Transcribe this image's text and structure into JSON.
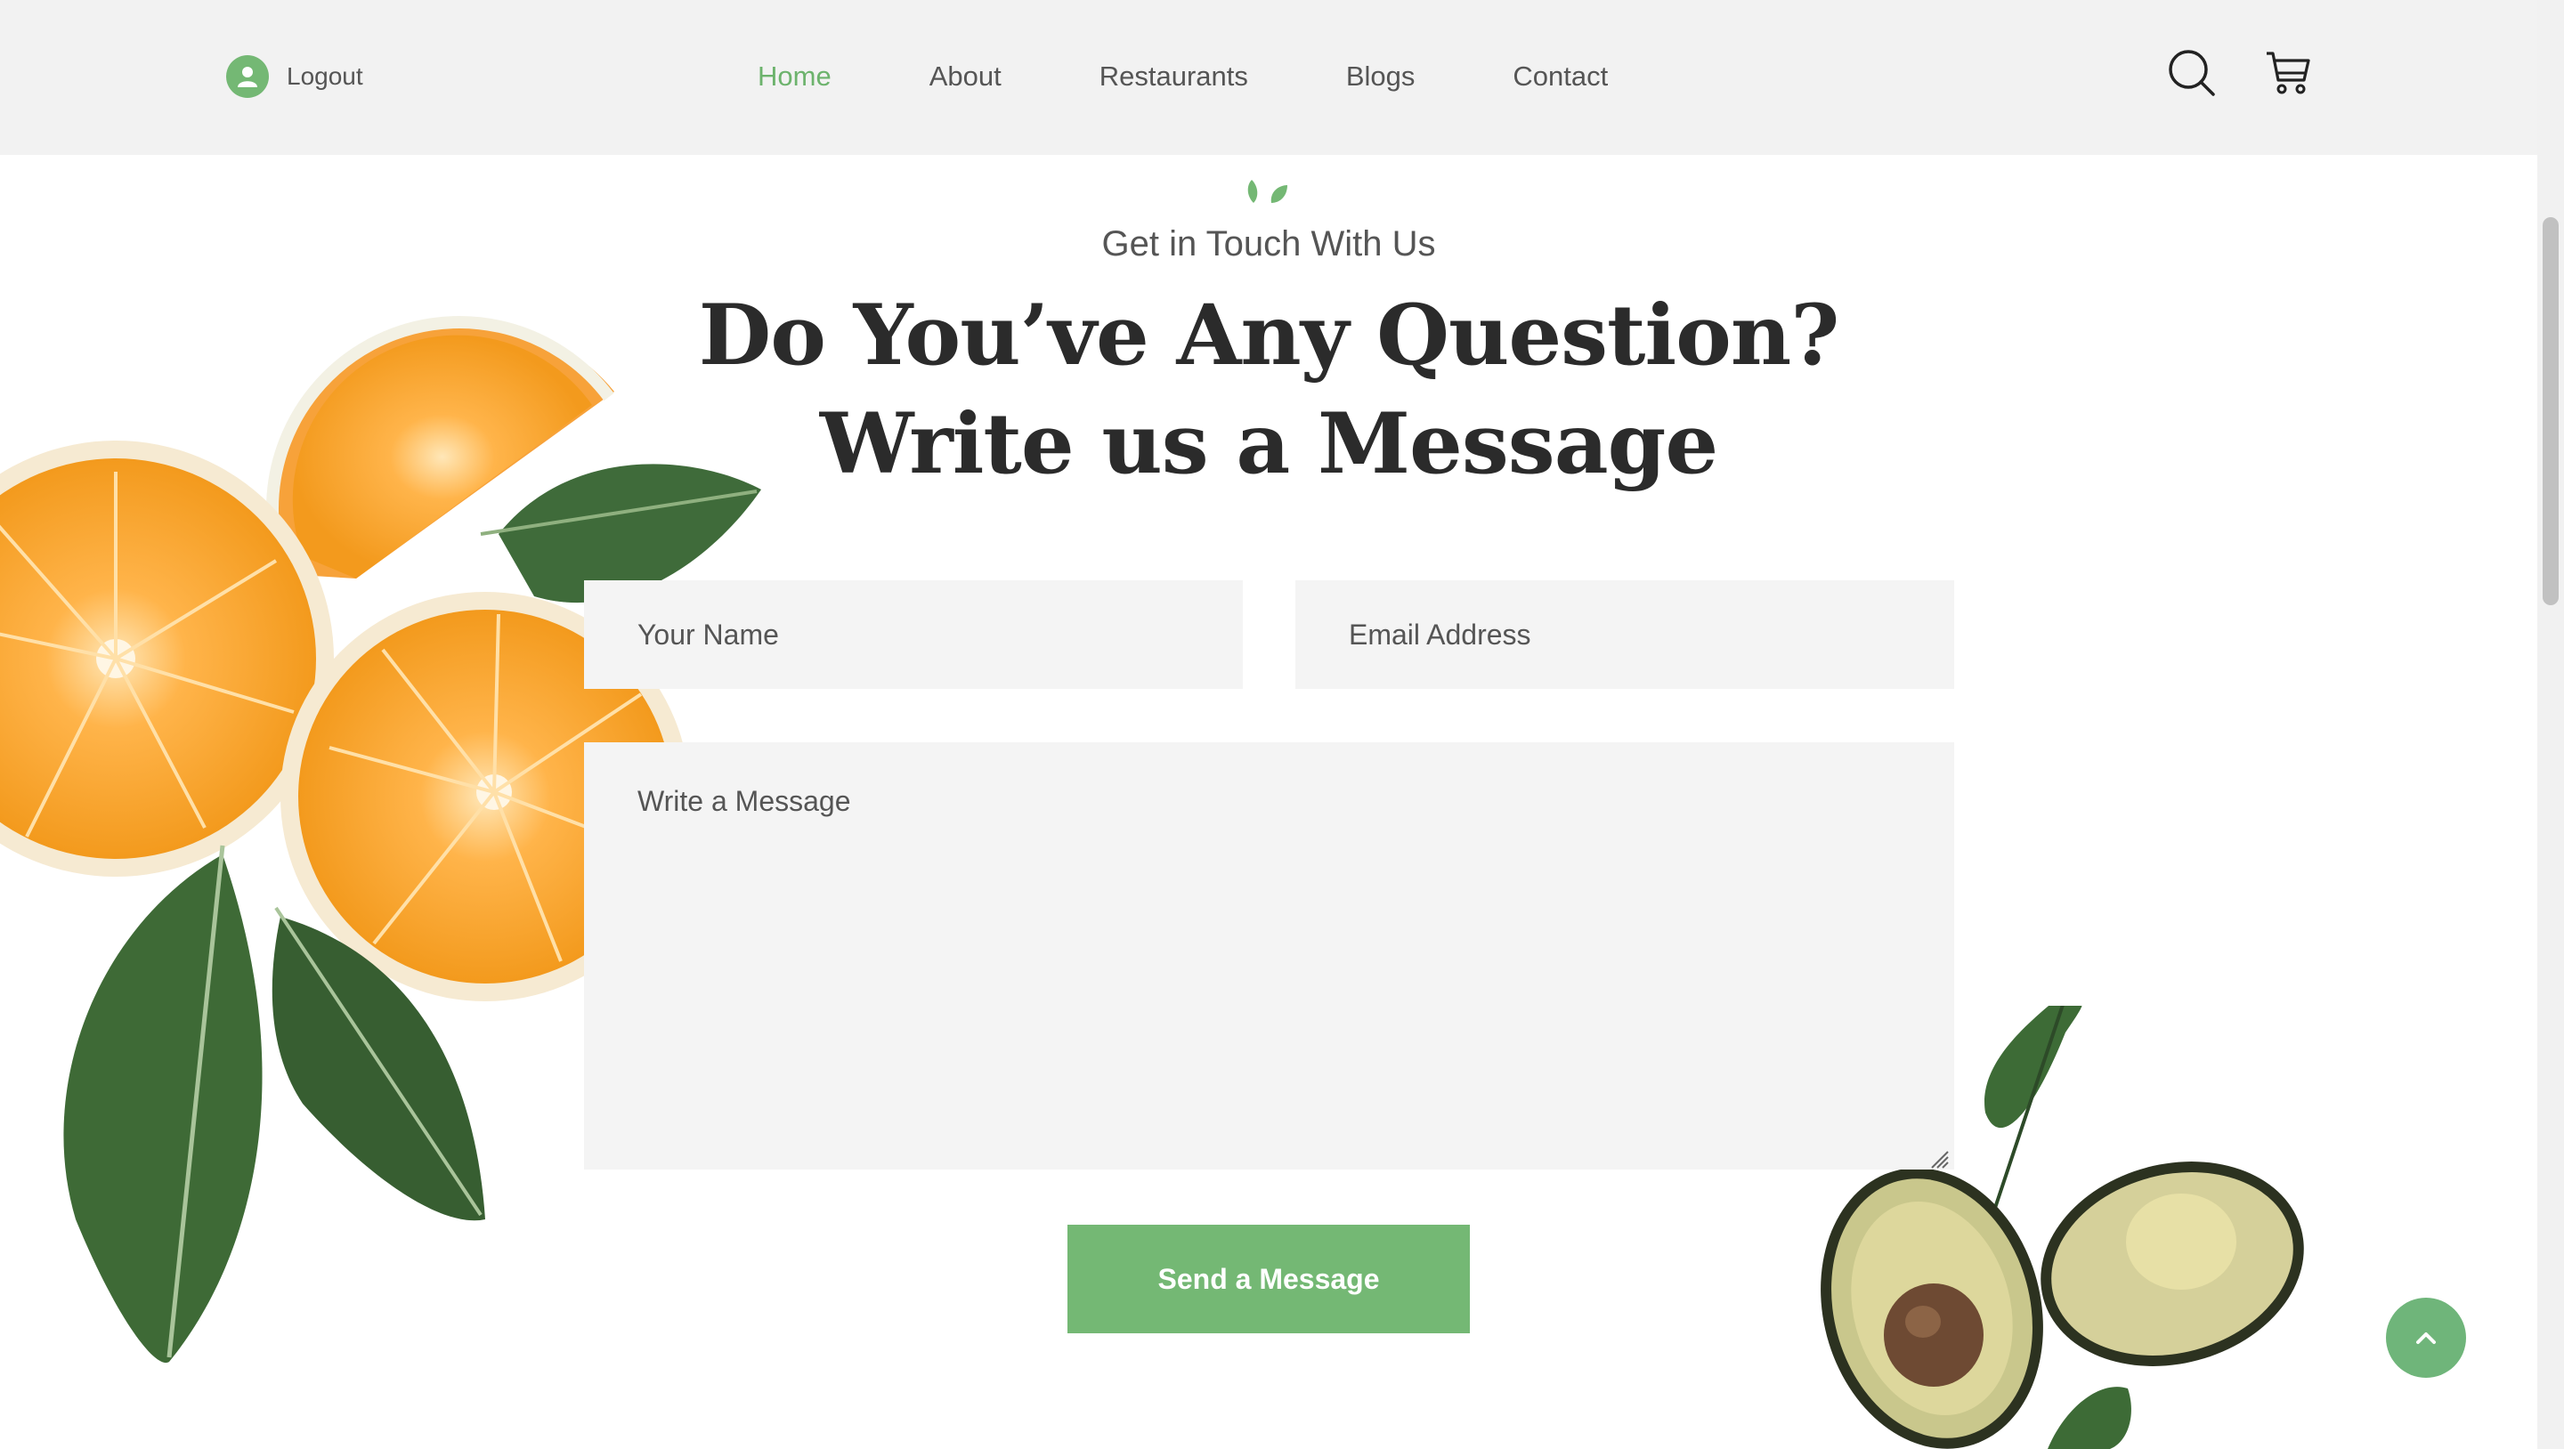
{
  "header": {
    "logout_label": "Logout",
    "nav": [
      {
        "label": "Home",
        "active": true
      },
      {
        "label": "About",
        "active": false
      },
      {
        "label": "Restaurants",
        "active": false
      },
      {
        "label": "Blogs",
        "active": false
      },
      {
        "label": "Contact",
        "active": false
      }
    ],
    "icons": [
      "user-icon",
      "search-icon",
      "cart-icon"
    ]
  },
  "hero": {
    "subtitle": "Get in Touch With Us",
    "title_line1": "Do You’ve Any Question?",
    "title_line2": "Write us a Message"
  },
  "form": {
    "name_placeholder": "Your Name",
    "email_placeholder": "Email Address",
    "message_placeholder": "Write a Message",
    "submit_label": "Send a Message"
  },
  "colors": {
    "accent": "#74b874",
    "header_bg": "#f2f2f2",
    "field_bg": "#f4f4f4",
    "title_text": "#2b2b2b"
  },
  "decorations": [
    "orange-slices-illustration",
    "avocado-illustration",
    "leaf-mark-icon",
    "chevron-up-icon"
  ]
}
